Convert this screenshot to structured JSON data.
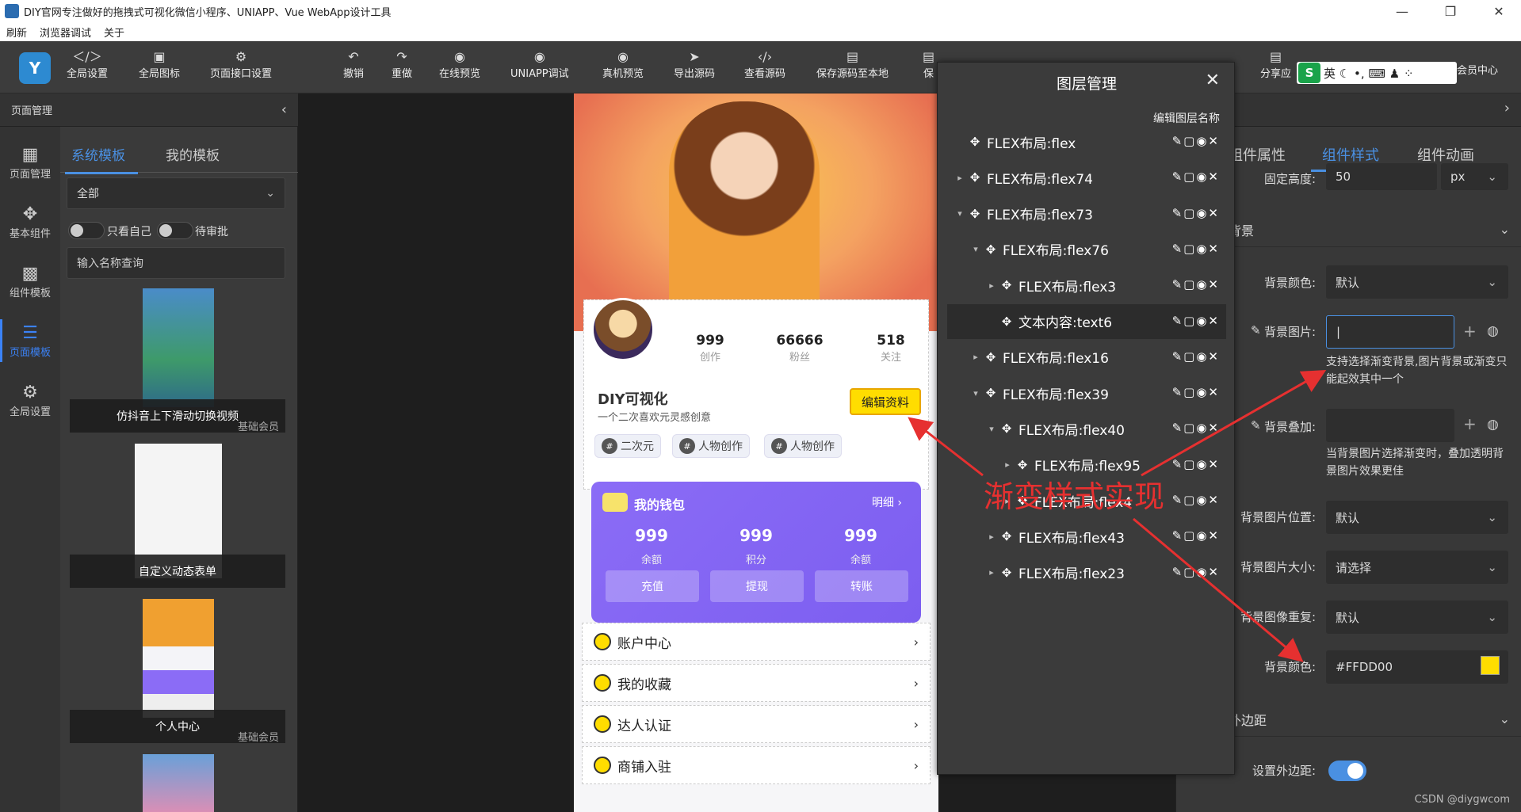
{
  "window": {
    "title": "DIY官网专注做好的拖拽式可视化微信小程序、UNIAPP、Vue WebApp设计工具",
    "controls": [
      "—",
      "❐",
      "✕"
    ]
  },
  "menubar": [
    "刷新",
    "浏览器调试",
    "关于"
  ],
  "toolbar": {
    "items": [
      "全局设置",
      "全局图标",
      "页面接口设置",
      "撤销",
      "重做",
      "在线预览",
      "UNIAPP调试",
      "真机预览",
      "导出源码",
      "查看源码",
      "保存源码至本地",
      "保",
      "分享应",
      "会员中心"
    ],
    "icons": [
      "＜/＞",
      "▣",
      "⚙",
      "↶",
      "↷",
      "◉",
      "◉",
      "◉",
      "➤",
      "‹/›",
      "▤",
      "▤"
    ]
  },
  "ime": {
    "badge": "S",
    "text": "英 ☾ •, ⌨ ♟ ⁘"
  },
  "left_panel": {
    "header": "页面管理",
    "nav": [
      {
        "label": "页面管理",
        "icon": "▦"
      },
      {
        "label": "基本组件",
        "icon": "✥"
      },
      {
        "label": "组件模板",
        "icon": "▩"
      },
      {
        "label": "页面模板",
        "icon": "☰"
      },
      {
        "label": "全局设置",
        "icon": "⚙"
      }
    ],
    "tabs": [
      "系统模板",
      "我的模板"
    ],
    "filter_select": "全部",
    "toggle_self": "只看自己",
    "toggle_review": "待审批",
    "search_placeholder": "输入名称查询",
    "templates": [
      {
        "name": "仿抖音上下滑动切换视频",
        "badge": "基础会员"
      },
      {
        "name": "自定义动态表单",
        "badge": ""
      },
      {
        "name": "个人中心",
        "badge": "基础会员"
      }
    ]
  },
  "phone": {
    "stats": [
      {
        "value": "999",
        "label": "创作"
      },
      {
        "value": "66666",
        "label": "粉丝"
      },
      {
        "value": "518",
        "label": "关注"
      }
    ],
    "nickname": "DIY可视化",
    "motto": "一个二次喜欢元灵感创意",
    "edit_button": "编辑资料",
    "chips": [
      "二次元",
      "人物创作",
      "人物创作"
    ],
    "wallet": {
      "title": "我的钱包",
      "detail": "明细 ›",
      "items": [
        {
          "value": "999",
          "label": "余额",
          "button": "充值"
        },
        {
          "value": "999",
          "label": "积分",
          "button": "提现"
        },
        {
          "value": "999",
          "label": "余额",
          "button": "转账"
        }
      ]
    },
    "menu": [
      "账户中心",
      "我的收藏",
      "达人认证",
      "商铺入驻"
    ]
  },
  "layer_panel": {
    "title": "图层管理",
    "subtitle": "编辑图层名称",
    "layers": [
      {
        "name": "FLEX布局:flex",
        "arrow": "",
        "depth": 0
      },
      {
        "name": "FLEX布局:flex74",
        "arrow": "▸",
        "depth": 0
      },
      {
        "name": "FLEX布局:flex73",
        "arrow": "▾",
        "depth": 0
      },
      {
        "name": "FLEX布局:flex76",
        "arrow": "▾",
        "depth": 1
      },
      {
        "name": "FLEX布局:flex3",
        "arrow": "▸",
        "depth": 2
      },
      {
        "name": "文本内容:text6",
        "arrow": "",
        "depth": 2,
        "selected": true
      },
      {
        "name": "FLEX布局:flex16",
        "arrow": "▸",
        "depth": 1
      },
      {
        "name": "FLEX布局:flex39",
        "arrow": "▾",
        "depth": 1
      },
      {
        "name": "FLEX布局:flex40",
        "arrow": "▾",
        "depth": 2
      },
      {
        "name": "FLEX布局:flex95",
        "arrow": "▸",
        "depth": 3
      },
      {
        "name": "FLEX布局:flex4",
        "arrow": "▸",
        "depth": 3
      },
      {
        "name": "FLEX布局:flex43",
        "arrow": "▸",
        "depth": 2
      },
      {
        "name": "FLEX布局:flex23",
        "arrow": "▸",
        "depth": 2
      }
    ],
    "actions": "✎▢◉✕"
  },
  "right_panel": {
    "tabs": [
      "组件属性",
      "组件样式",
      "组件动画"
    ],
    "fixed_height_label": "固定高度:",
    "fixed_height_value": "50",
    "fixed_height_unit": "px",
    "section_bg": "背景",
    "bg_color_label": "背景颜色:",
    "bg_color_value": "默认",
    "bg_image_label": "背景图片:",
    "bg_image_value": "|",
    "bg_image_note": "支持选择渐变背景,图片背景或渐变只能起效其中一个",
    "bg_overlay_label": "背景叠加:",
    "bg_overlay_note": "当背景图片选择渐变时，叠加透明背景图片效果更佳",
    "bg_pos_label": "背景图片位置:",
    "bg_pos_value": "默认",
    "bg_size_label": "背景图片大小:",
    "bg_size_value": "请选择",
    "bg_repeat_label": "背景图像重复:",
    "bg_repeat_value": "默认",
    "bg_color2_label": "背景颜色:",
    "bg_color2_value": "#FFDD00",
    "section_margin": "外边距",
    "margin_toggle_label": "设置外边距:"
  },
  "annotation": "渐变样式实现",
  "watermark": "CSDN @diygwcom",
  "colors": {
    "accent": "#4a90e2",
    "highlight": "#FFDD00",
    "annotation": "#e63030",
    "wallet": "#7c5ef0"
  }
}
